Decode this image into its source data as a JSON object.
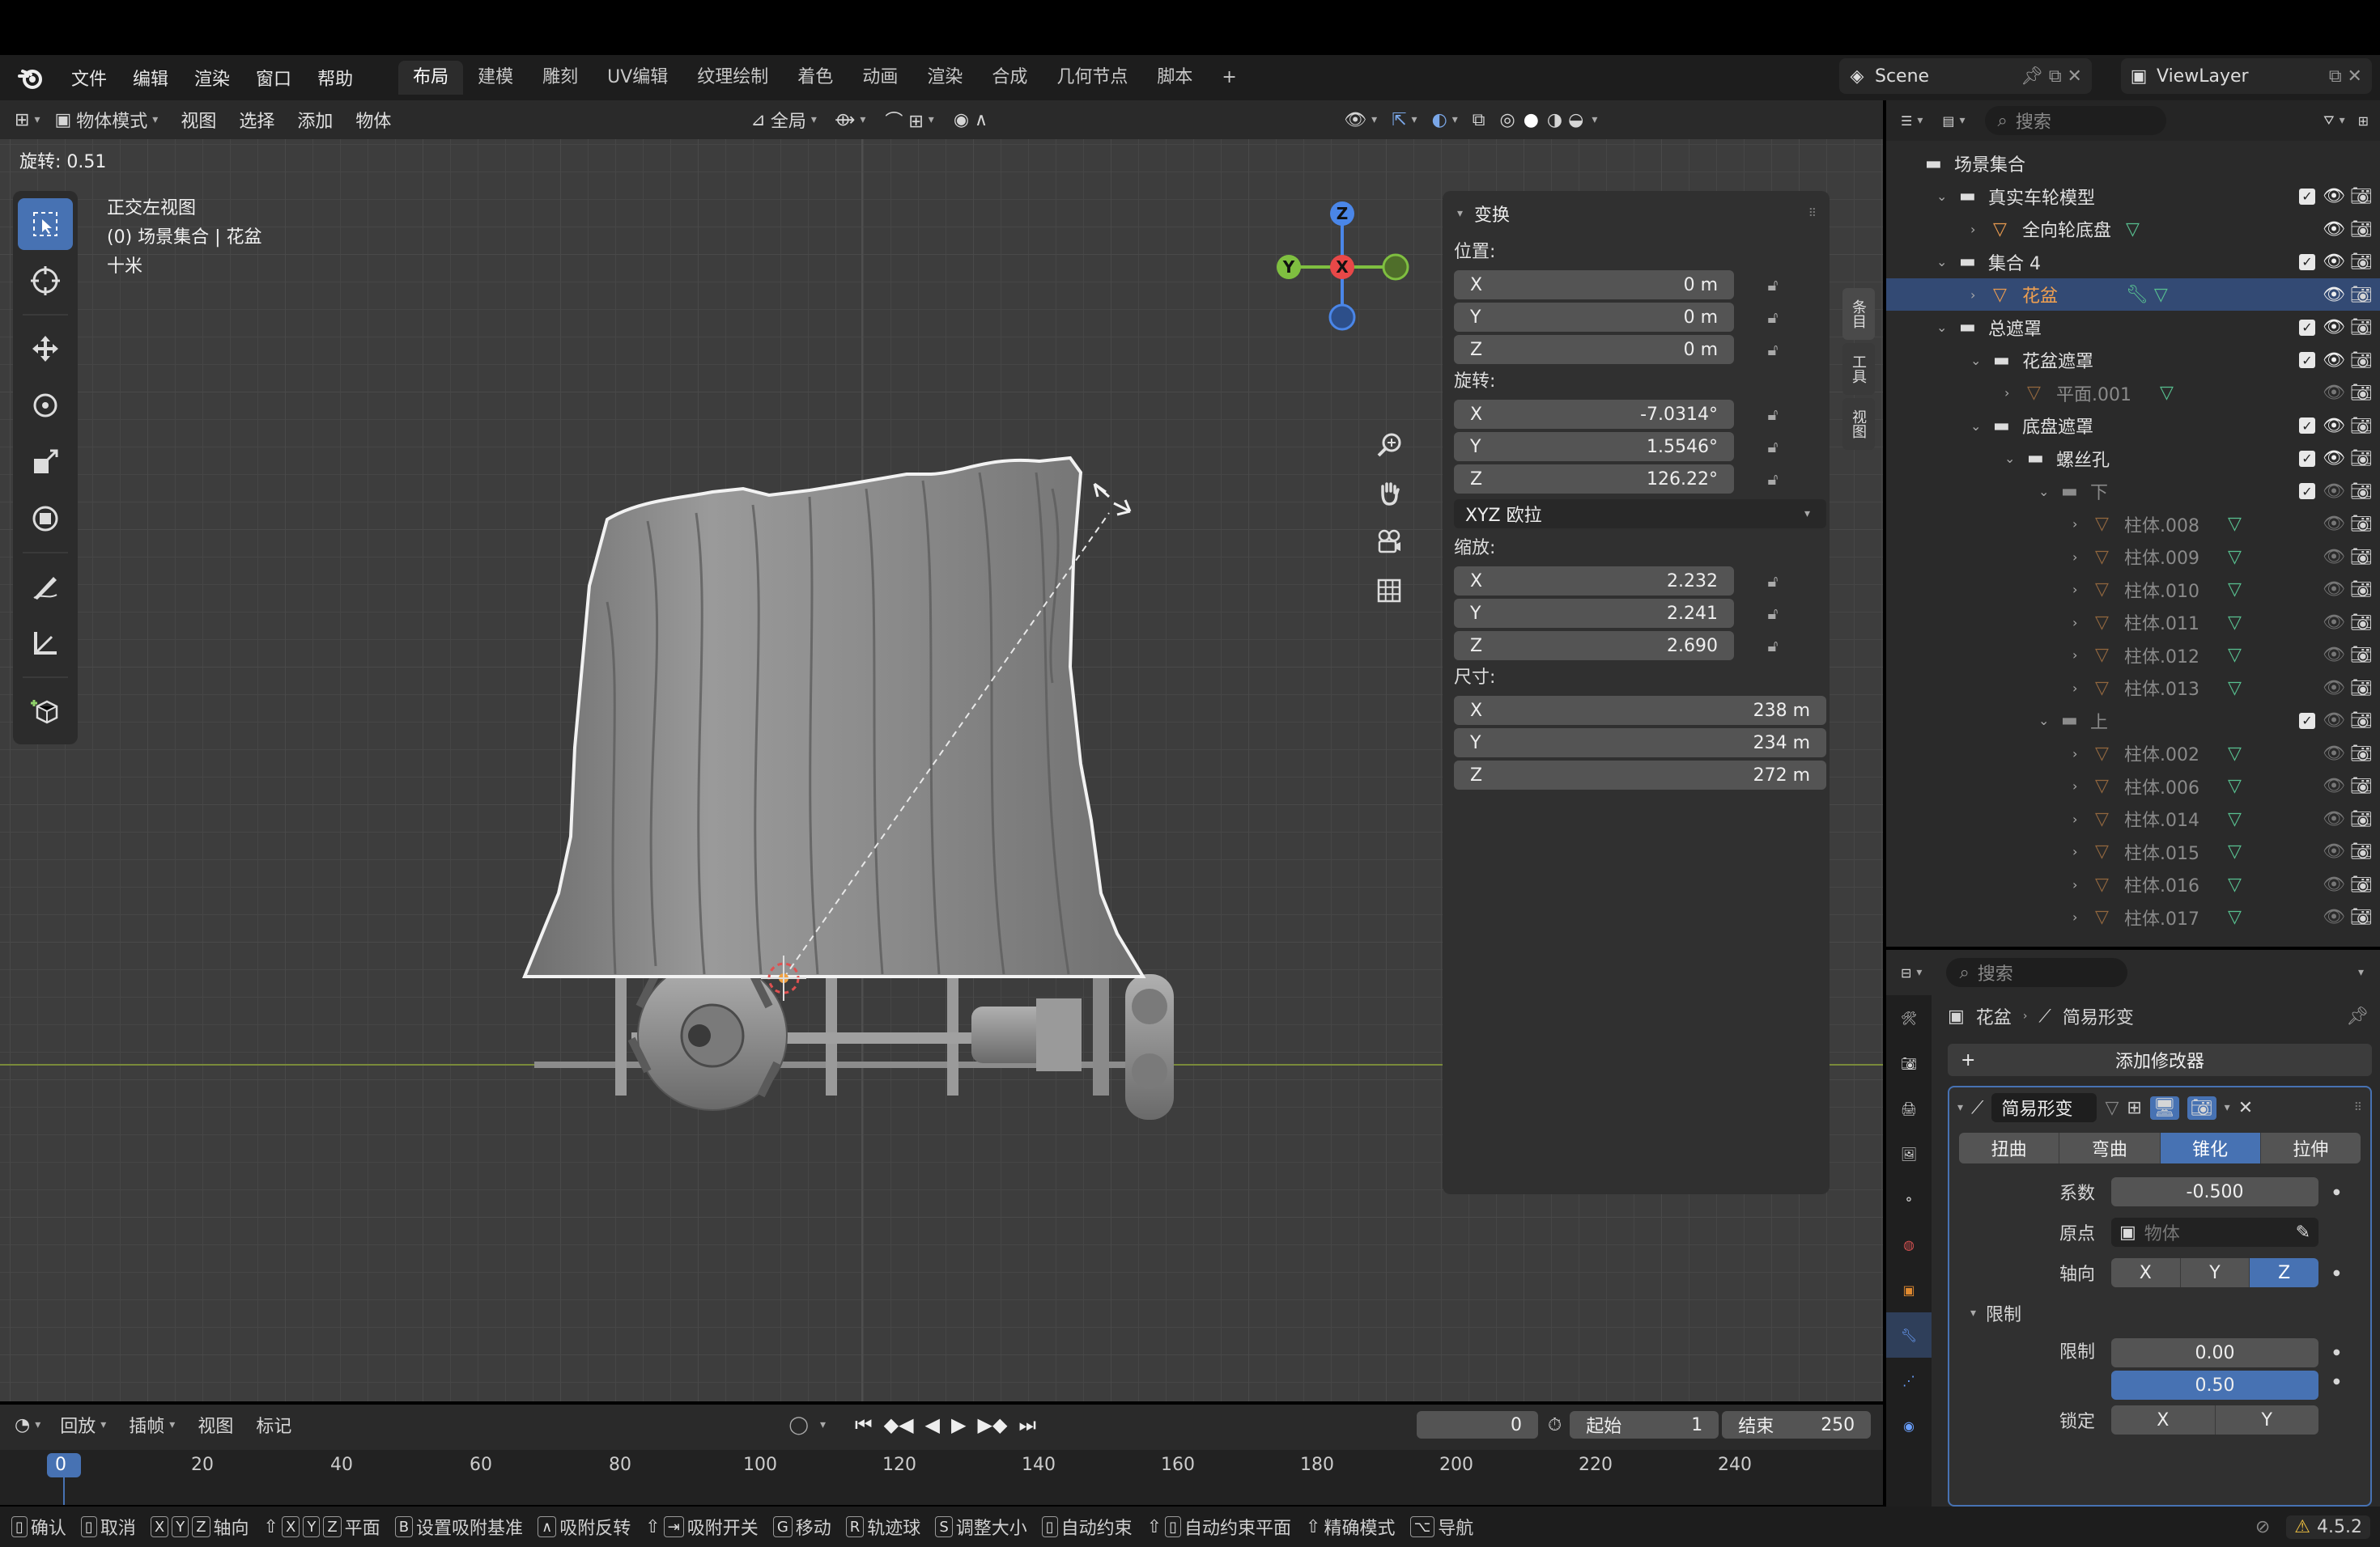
{
  "menubar": {
    "items": [
      "文件",
      "编辑",
      "渲染",
      "窗口",
      "帮助"
    ],
    "tabs": [
      "布局",
      "建模",
      "雕刻",
      "UV编辑",
      "纹理绘制",
      "着色",
      "动画",
      "渲染",
      "合成",
      "几何节点",
      "脚本"
    ],
    "active_tab": "布局",
    "scene": "Scene",
    "view_layer": "ViewLayer"
  },
  "viewport": {
    "mode": "物体模式",
    "menus": [
      "视图",
      "选择",
      "添加",
      "物体"
    ],
    "transform_orientation": "全局",
    "operator_info": "旋转: 0.51",
    "view_name": "正交左视图",
    "collection_line": "(0) 场景集合 | 花盆",
    "scale_line": "十米",
    "last_op_panel": "缩放"
  },
  "gizmo": {
    "z": "Z",
    "y": "Y",
    "x": "X"
  },
  "npanel": {
    "section": "变换",
    "location_label": "位置:",
    "location": [
      {
        "axis": "X",
        "value": "0 m"
      },
      {
        "axis": "Y",
        "value": "0 m"
      },
      {
        "axis": "Z",
        "value": "0 m"
      }
    ],
    "rotation_label": "旋转:",
    "rotation": [
      {
        "axis": "X",
        "value": "-7.0314°"
      },
      {
        "axis": "Y",
        "value": "1.5546°"
      },
      {
        "axis": "Z",
        "value": "126.22°"
      }
    ],
    "rotation_mode": "XYZ 欧拉",
    "scale_label": "缩放:",
    "scale": [
      {
        "axis": "X",
        "value": "2.232"
      },
      {
        "axis": "Y",
        "value": "2.241"
      },
      {
        "axis": "Z",
        "value": "2.690"
      }
    ],
    "dims_label": "尺寸:",
    "dims": [
      {
        "axis": "X",
        "value": "238 m"
      },
      {
        "axis": "Y",
        "value": "234 m"
      },
      {
        "axis": "Z",
        "value": "272 m"
      }
    ],
    "tabs": [
      "条目",
      "工具",
      "视图"
    ]
  },
  "timeline": {
    "menus": [
      "回放",
      "插帧",
      "视图",
      "标记"
    ],
    "current_frame": "0",
    "start_label": "起始",
    "start": "1",
    "end_label": "结束",
    "end": "250",
    "ticks": [
      "0",
      "20",
      "40",
      "60",
      "80",
      "100",
      "120",
      "140",
      "160",
      "180",
      "200",
      "220",
      "240"
    ]
  },
  "statusbar": {
    "items": [
      "确认",
      "取消",
      "X",
      "Y",
      "Z",
      "轴向",
      "X",
      "Y",
      "Z",
      "平面",
      "B",
      "设置吸附基准",
      "吸附反转",
      "吸附开关",
      "G",
      "移动",
      "R",
      "轨迹球",
      "S",
      "调整大小",
      "自动约束",
      "自动约束平面",
      "精确模式",
      "导航"
    ],
    "version": "4.5.2"
  },
  "outliner": {
    "search_placeholder": "搜索",
    "rows": [
      {
        "name": "场景集合",
        "depth": 0,
        "type": "scene"
      },
      {
        "name": "真实车轮模型",
        "depth": 1,
        "type": "coll",
        "chk": true
      },
      {
        "name": "全向轮底盘",
        "depth": 2,
        "type": "mesh"
      },
      {
        "name": "集合 4",
        "depth": 1,
        "type": "coll",
        "chk": true
      },
      {
        "name": "花盆",
        "depth": 2,
        "type": "mesh",
        "sel": true
      },
      {
        "name": "总遮罩",
        "depth": 1,
        "type": "coll",
        "chk": true
      },
      {
        "name": "花盆遮罩",
        "depth": 2,
        "type": "coll",
        "chk": true
      },
      {
        "name": "平面.001",
        "depth": 3,
        "type": "mesh",
        "dim": true
      },
      {
        "name": "底盘遮罩",
        "depth": 2,
        "type": "coll",
        "chk": true
      },
      {
        "name": "螺丝孔",
        "depth": 3,
        "type": "coll",
        "chk": true
      },
      {
        "name": "下",
        "depth": 4,
        "type": "coll",
        "chk": true,
        "dim": true
      },
      {
        "name": "柱体.008",
        "depth": 5,
        "type": "mesh",
        "dim": true
      },
      {
        "name": "柱体.009",
        "depth": 5,
        "type": "mesh",
        "dim": true
      },
      {
        "name": "柱体.010",
        "depth": 5,
        "type": "mesh",
        "dim": true
      },
      {
        "name": "柱体.011",
        "depth": 5,
        "type": "mesh",
        "dim": true
      },
      {
        "name": "柱体.012",
        "depth": 5,
        "type": "mesh",
        "dim": true
      },
      {
        "name": "柱体.013",
        "depth": 5,
        "type": "mesh",
        "dim": true
      },
      {
        "name": "上",
        "depth": 4,
        "type": "coll",
        "chk": true,
        "dim": true
      },
      {
        "name": "柱体.002",
        "depth": 5,
        "type": "mesh",
        "dim": true
      },
      {
        "name": "柱体.006",
        "depth": 5,
        "type": "mesh",
        "dim": true
      },
      {
        "name": "柱体.014",
        "depth": 5,
        "type": "mesh",
        "dim": true
      },
      {
        "name": "柱体.015",
        "depth": 5,
        "type": "mesh",
        "dim": true
      },
      {
        "name": "柱体.016",
        "depth": 5,
        "type": "mesh",
        "dim": true
      },
      {
        "name": "柱体.017",
        "depth": 5,
        "type": "mesh",
        "dim": true
      }
    ]
  },
  "props": {
    "search_placeholder": "搜索",
    "object": "花盆",
    "modifier": "简易形变",
    "add_modifier": "添加修改器",
    "modifier_name": "简易形变",
    "modes": [
      "扭曲",
      "弯曲",
      "锥化",
      "拉伸"
    ],
    "active_mode": "锥化",
    "factor_label": "系数",
    "factor": "-0.500",
    "origin_label": "原点",
    "origin_placeholder": "物体",
    "axis_label": "轴向",
    "axes": [
      "X",
      "Y",
      "Z"
    ],
    "active_axis": "Z",
    "limits_section": "限制",
    "limit_label": "限制",
    "limit_low": "0.00",
    "limit_high": "0.50",
    "lock_label": "锁定",
    "lock_axes": [
      "X",
      "Y"
    ]
  }
}
